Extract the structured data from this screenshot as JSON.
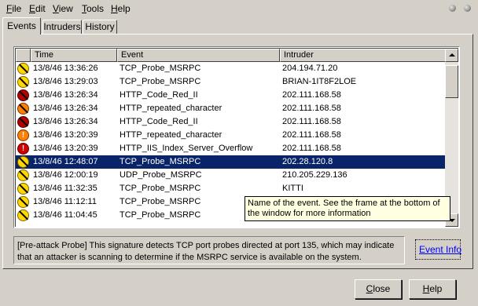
{
  "menu": {
    "items": [
      {
        "ul": "F",
        "rest": "ile"
      },
      {
        "ul": "E",
        "rest": "dit"
      },
      {
        "ul": "V",
        "rest": "iew"
      },
      {
        "ul": "T",
        "rest": "ools"
      },
      {
        "ul": "H",
        "rest": "elp"
      }
    ]
  },
  "tabs": [
    "Events",
    "Intruders",
    "History"
  ],
  "columns": [
    "Time",
    "Event",
    "Intruder"
  ],
  "rows": [
    {
      "icon": "yellow-slash",
      "time": "13/8/46 13:36:26",
      "event": "TCP_Probe_MSRPC",
      "intruder": "204.194.71.20"
    },
    {
      "icon": "yellow-slash",
      "time": "13/8/46 13:29:03",
      "event": "TCP_Probe_MSRPC",
      "intruder": "BRIAN-1IT8F2LOE"
    },
    {
      "icon": "darkred-slash",
      "time": "13/8/46 13:26:34",
      "event": "HTTP_Code_Red_II",
      "intruder": "202.111.168.58"
    },
    {
      "icon": "orange-slash",
      "time": "13/8/46 13:26:34",
      "event": "HTTP_repeated_character",
      "intruder": "202.111.168.58"
    },
    {
      "icon": "darkred-slash",
      "time": "13/8/46 13:26:34",
      "event": "HTTP_Code_Red_II",
      "intruder": "202.111.168.58"
    },
    {
      "icon": "orange-bang",
      "time": "13/8/46 13:20:39",
      "event": "HTTP_repeated_character",
      "intruder": "202.111.168.58"
    },
    {
      "icon": "red-bang",
      "time": "13/8/46 13:20:39",
      "event": "HTTP_IIS_Index_Server_Overflow",
      "intruder": "202.111.168.58"
    },
    {
      "icon": "yellow-slash",
      "time": "13/8/46 12:48:07",
      "event": "TCP_Probe_MSRPC",
      "intruder": "202.28.120.8",
      "selected": true
    },
    {
      "icon": "yellow-slash",
      "time": "13/8/46 12:00:19",
      "event": "UDP_Probe_MSRPC",
      "intruder": "210.205.229.136"
    },
    {
      "icon": "yellow-slash",
      "time": "13/8/46 11:32:35",
      "event": "TCP_Probe_MSRPC",
      "intruder": "KITTI"
    },
    {
      "icon": "yellow-slash",
      "time": "13/8/46 11:12:11",
      "event": "TCP_Probe_MSRPC",
      "intruder": ""
    },
    {
      "icon": "yellow-slash",
      "time": "13/8/46 11:04:45",
      "event": "TCP_Probe_MSRPC",
      "intruder": ""
    }
  ],
  "tooltip": "Name of the event. See the frame at the bottom of the window for more information",
  "description": "[Pre-attack Probe] This signature detects TCP port probes directed at port 135, which may indicate that an attacker is scanning to determine if the MSRPC service is available on the system.",
  "event_info_link": "Event Info",
  "buttons": {
    "close": {
      "ul": "C",
      "rest": "lose"
    },
    "help": {
      "ul": "H",
      "rest": "elp"
    }
  },
  "colors": {
    "window_bg": "#d4d0c8",
    "selection_bg": "#0a246a",
    "tooltip_bg": "#ffffe1",
    "link": "#0000ff"
  }
}
